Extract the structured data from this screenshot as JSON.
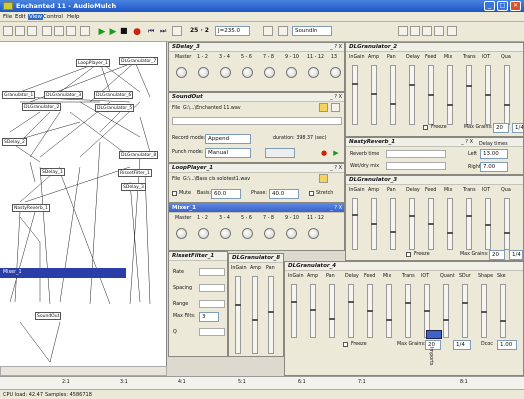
{
  "window": {
    "title": "Enchanted 11 - AudioMulch",
    "min": "_",
    "max": "□",
    "close": "✕"
  },
  "menu": [
    "File",
    "Edit",
    "View",
    "Control",
    "Help"
  ],
  "toolbar": {
    "bar_beat": "25 · 2",
    "tempo": "J=235.0",
    "sound_in": "SoundIn"
  },
  "patch": {
    "nodes": [
      "LoopPlayer_1",
      "DLGranulator_7",
      "Granulator_1",
      "DLGranulator_3",
      "DLGranulator_6",
      "DLGranulator_2",
      "DLGranulator_5",
      "DLGranulator_8",
      "SDelay_2",
      "SDelay_1",
      "SDelay_3",
      "RissetFilter_1",
      "NastyReverb_1",
      "Mixer_1",
      "SoundOut"
    ]
  },
  "sdelays": {
    "title": "SDelay_3",
    "win_ctl": "_ ? X"
  },
  "mixer_top": {
    "labels": [
      "Master",
      "1 - 2",
      "3 - 4",
      "5 - 6",
      "7 - 8",
      "9 - 10",
      "11 - 12",
      "13"
    ]
  },
  "soundout": {
    "title": "SoundOut",
    "win_ctl": "_ ? X",
    "file_label": "File",
    "file_path": "G:\\...\\Enchanted 11.wav",
    "record_mode_label": "Record mode:",
    "record_mode": "Append",
    "duration": "duration: 398.37 (sec)",
    "punch_mode_label": "Punch mode:",
    "punch_mode": "Manual"
  },
  "loopplayer": {
    "title": "LoopPlayer_1",
    "win_ctl": "_ ? X",
    "file_label": "File",
    "file_path": "G:\\...\\Bass cls solotest1.wav",
    "mute": "Mute",
    "basis_label": "Basis:",
    "basis": "60.0",
    "phase_label": "Phase:",
    "phase": "40.0",
    "stretch": "Stretch"
  },
  "mixer1": {
    "title": "Mixer_1",
    "win_ctl": "_ ? X",
    "labels": [
      "Master",
      "1 - 2",
      "3 - 4",
      "5 - 6",
      "7 - 8",
      "9 - 10",
      "11 - 12"
    ]
  },
  "rissetfilter": {
    "title": "RissetFilter_1",
    "win_ctl": "_ ? X",
    "labels": [
      "Rate",
      "Spacing",
      "Range",
      "Max Filts:",
      "Q"
    ],
    "max_filts": "3"
  },
  "dlgran8": {
    "title": "DLGranulator_8",
    "cols": [
      "InGain",
      "Amp",
      "Pan"
    ]
  },
  "dlgran4": {
    "title": "DLGranulator_4",
    "cols": [
      "InGain",
      "Amp",
      "Pan",
      "Delay",
      "Feed",
      "Mix",
      "Trans",
      "IOT",
      "Quant",
      "SDur",
      "Shape",
      "Ske"
    ],
    "freeze": "Freeze",
    "max_grains_label": "Max Grains:",
    "max_grains": "20",
    "frac": "1/4",
    "dcoc_label": "Dcoc",
    "dcoc": "1.00"
  },
  "dlgran2": {
    "title": "DLGranulator_2",
    "cols": [
      "InGain",
      "Amp",
      "Pan",
      "Delay",
      "Feed",
      "Mix",
      "Trans",
      "IOT",
      "Qua"
    ],
    "freeze": "Freeze",
    "max_grains_label": "Max Grains:",
    "max_grains": "20",
    "frac": "1/4"
  },
  "nastyreverb": {
    "title": "NastyReverb_1",
    "win_ctl": "_ ? X",
    "reverb_time": "Reverb time",
    "wet_dry": "Wet/dry mix",
    "delay_label": "Delay times",
    "left_label": "Left",
    "left": "13.00",
    "right_label": "Right",
    "right": "7.00"
  },
  "dlgran3": {
    "title": "DLGranulator_3",
    "cols": [
      "InGain",
      "Amp",
      "Pan",
      "Delay",
      "Feed",
      "Mix",
      "Trans",
      "IOT",
      "Qua"
    ],
    "freeze": "Freeze",
    "max_grains_label": "Max Grains:",
    "max_grains": "20",
    "frac": "1/4"
  },
  "ruler": {
    "marks": [
      "2:1",
      "3:1",
      "4:1",
      "5:1",
      "6:1",
      "7:1",
      "8:1"
    ],
    "vlabel": "Imports"
  },
  "status": {
    "cpu": "CPU load: 42.47",
    "samples": "Samples: 4586718"
  }
}
